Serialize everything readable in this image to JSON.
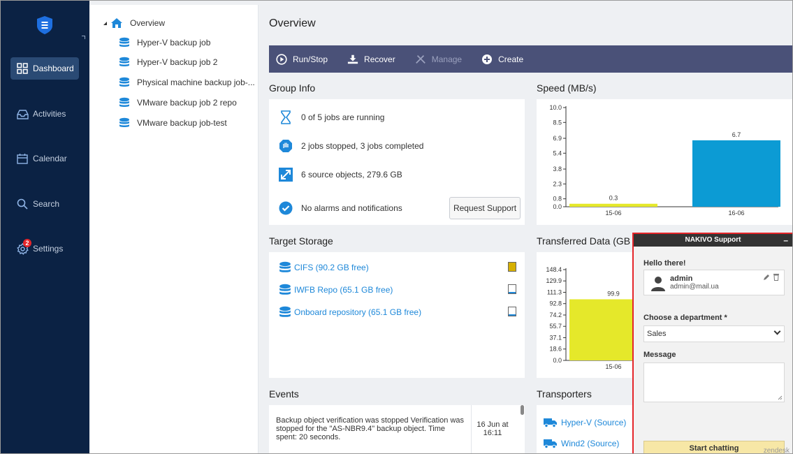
{
  "nav": {
    "items": [
      {
        "label": "Dashboard",
        "icon": "dashboard-icon"
      },
      {
        "label": "Activities",
        "icon": "inbox-icon"
      },
      {
        "label": "Calendar",
        "icon": "calendar-icon"
      },
      {
        "label": "Search",
        "icon": "search-icon"
      },
      {
        "label": "Settings",
        "icon": "gear-icon",
        "badge": "2"
      }
    ]
  },
  "tree": {
    "root": "Overview",
    "items": [
      "Hyper-V backup job",
      "Hyper-V backup job 2",
      "Physical machine backup job-...",
      "VMware backup job 2 repo",
      "VMware backup job-test"
    ]
  },
  "main": {
    "title": "Overview",
    "toolbar": {
      "run_stop": "Run/Stop",
      "recover": "Recover",
      "manage": "Manage",
      "create": "Create"
    },
    "group_info": {
      "title": "Group Info",
      "jobs_running": "0 of 5 jobs are running",
      "jobs_status": "2 jobs stopped, 3 jobs completed",
      "source_objects": "6 source objects, 279.6 GB",
      "alarms": "No alarms and notifications",
      "request_support": "Request Support"
    },
    "target_storage": {
      "title": "Target Storage",
      "items": [
        {
          "label": "CIFS (90.2 GB free)",
          "fill": 1.0,
          "fill_color": "#d6b000"
        },
        {
          "label": "IWFB Repo (65.1 GB free)",
          "fill": 0.2,
          "fill_color": "#1e88d9"
        },
        {
          "label": "Onboard repository (65.1 GB free)",
          "fill": 0.2,
          "fill_color": "#1e88d9"
        }
      ]
    },
    "events": {
      "title": "Events",
      "items": [
        {
          "text": "Backup object verification was stopped Verification was stopped for the \"AS-NBR9.4\" backup object. Time spent: 20 seconds.",
          "date": "16 Jun at 16:11"
        }
      ]
    },
    "transporters": {
      "title": "Transporters",
      "items": [
        "Hyper-V (Source)",
        "Wind2 (Source)"
      ]
    }
  },
  "speed_title": "Speed (MB/s)",
  "transferred_title": "Transferred Data (GB",
  "chart_data": [
    {
      "type": "bar",
      "title": "Speed (MB/s)",
      "categories": [
        "15-06",
        "16-06"
      ],
      "values": [
        0.3,
        6.7
      ],
      "value_labels": [
        "0.3",
        "6.7"
      ],
      "colors": [
        "#e5e82a",
        "#0c9bd4"
      ],
      "yticks": [
        "0.0",
        "0.8",
        "2.3",
        "3.8",
        "5.4",
        "6.9",
        "8.5",
        "10.0"
      ],
      "ylim": [
        0,
        10.0
      ],
      "xlabel": "",
      "ylabel": ""
    },
    {
      "type": "bar",
      "title": "Transferred Data (GB",
      "categories": [
        "15-06"
      ],
      "values": [
        99.9
      ],
      "value_labels": [
        "99.9"
      ],
      "colors": [
        "#e5e82a"
      ],
      "yticks": [
        "0.0",
        "18.6",
        "37.1",
        "55.7",
        "74.2",
        "92.8",
        "111.3",
        "129.9",
        "148.4"
      ],
      "ylim": [
        0,
        148.4
      ],
      "xlabel": "",
      "ylabel": ""
    }
  ],
  "support": {
    "header": "NAKIVO Support",
    "minimize": "–",
    "hello": "Hello there!",
    "user_name": "admin",
    "user_email": "admin@mail.ua",
    "department_label": "Choose a department *",
    "department_value": "Sales",
    "message_label": "Message",
    "start_button": "Start chatting",
    "footer": "zendesk"
  }
}
